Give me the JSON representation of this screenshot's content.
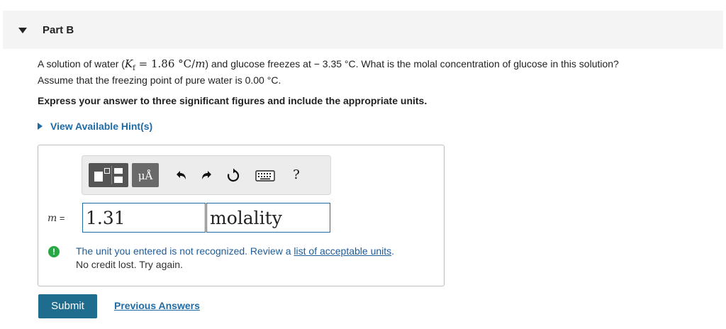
{
  "part": {
    "title": "Part B"
  },
  "question": {
    "intro": "A solution of water (",
    "kf_symbol": "K",
    "kf_sub": "f",
    "kf_value": " = 1.86 °C/",
    "kf_unit_m": "m",
    "mid": ") and glucose freezes at − 3.35 °C. What is the molal concentration of glucose in this solution?",
    "line2": "Assume that the freezing point of pure water is 0.00 °C."
  },
  "instruction": "Express your answer to three significant figures and include the appropriate units.",
  "hint": {
    "label": "View Available Hint(s)"
  },
  "toolbar": {
    "templates_icon": "templates-icon",
    "units_label": "μÅ",
    "undo_icon": "undo-icon",
    "redo_icon": "redo-icon",
    "reset_icon": "reset-icon",
    "keyboard_icon": "keyboard-icon",
    "help_label": "?"
  },
  "answer": {
    "variable": "m",
    "equals": " =",
    "value": "1.31",
    "unit": "molality"
  },
  "feedback": {
    "text_before_link": "The unit you entered is not recognized. Review a ",
    "link": "list of acceptable units",
    "text_after_link": ".",
    "line2": "No credit lost. Try again.",
    "icon": "!"
  },
  "actions": {
    "submit": "Submit",
    "previous_answers": "Previous Answers"
  },
  "colors": {
    "accent": "#1f6ba6",
    "submit_bg": "#1f6d8e",
    "warning_icon": "#27a745"
  }
}
